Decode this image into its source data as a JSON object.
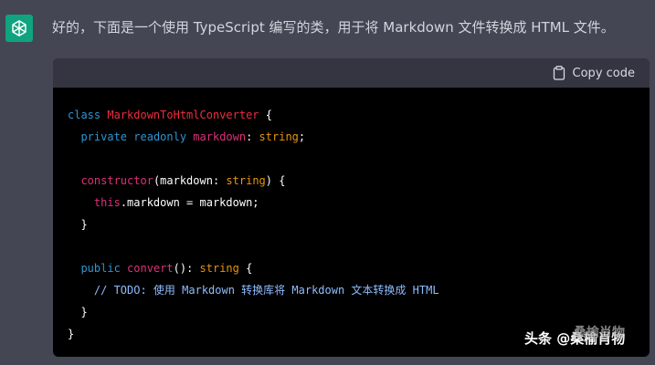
{
  "message": {
    "text": "好的，下面是一个使用 TypeScript 编写的类，用于将 Markdown 文件转换成 HTML 文件。"
  },
  "code_block": {
    "copy_label": "Copy code",
    "copy_icon": "clipboard-icon",
    "lines": [
      [
        [
          "kw",
          "class "
        ],
        [
          "cls",
          "MarkdownToHtmlConverter"
        ],
        [
          "plain",
          " {"
        ]
      ],
      [
        [
          "plain",
          "  "
        ],
        [
          "kw",
          "private"
        ],
        [
          "plain",
          " "
        ],
        [
          "kw",
          "readonly"
        ],
        [
          "plain",
          " "
        ],
        [
          "type",
          "markdown"
        ],
        [
          "plain",
          ": "
        ],
        [
          "str",
          "string"
        ],
        [
          "plain",
          ";"
        ]
      ],
      [],
      [
        [
          "plain",
          "  "
        ],
        [
          "type",
          "constructor"
        ],
        [
          "plain",
          "(markdown: "
        ],
        [
          "str",
          "string"
        ],
        [
          "plain",
          ") {"
        ]
      ],
      [
        [
          "plain",
          "    "
        ],
        [
          "this",
          "this"
        ],
        [
          "plain",
          ".markdown = markdown;"
        ]
      ],
      [
        [
          "plain",
          "  }"
        ]
      ],
      [],
      [
        [
          "plain",
          "  "
        ],
        [
          "kw",
          "public"
        ],
        [
          "plain",
          " "
        ],
        [
          "type",
          "convert"
        ],
        [
          "plain",
          "(): "
        ],
        [
          "str",
          "string"
        ],
        [
          "plain",
          " {"
        ]
      ],
      [
        [
          "plain",
          "    "
        ],
        [
          "cmt",
          "// TODO: 使用 Markdown 转换库将 Markdown 文本转换成 HTML"
        ]
      ],
      [
        [
          "plain",
          "  }"
        ]
      ],
      [
        [
          "plain",
          "}"
        ]
      ]
    ]
  },
  "watermark": {
    "text": "头条 @桑榆肖物",
    "ghost_text": "桑榆肖物"
  },
  "colors": {
    "background": "#444654",
    "code_bg": "#000000",
    "header_bg": "#343541",
    "avatar": "#10a37f"
  }
}
